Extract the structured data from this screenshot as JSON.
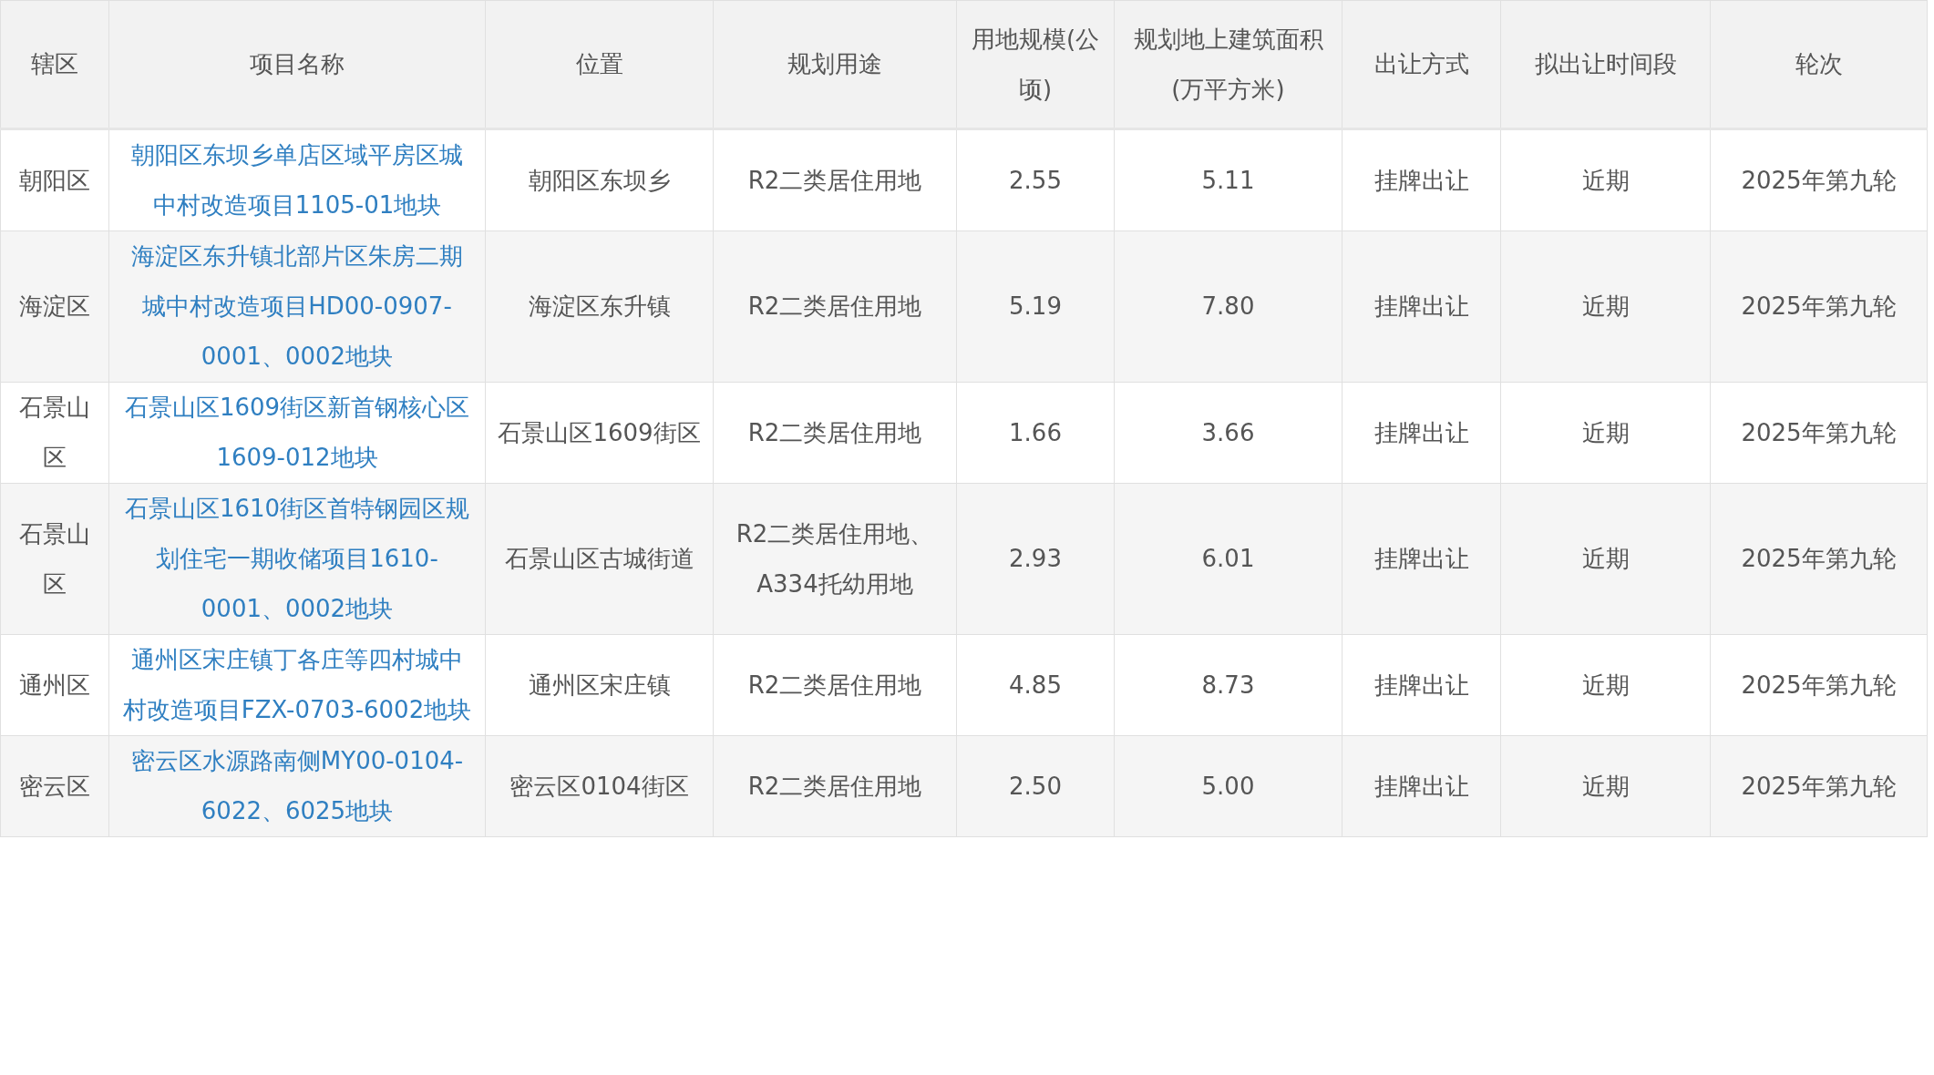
{
  "table": {
    "columns": [
      "辖区",
      "项目名称",
      "位置",
      "规划用途",
      "用地规模(公顷)",
      "规划地上建筑面积(万平方米)",
      "出让方式",
      "拟出让时间段",
      "轮次"
    ],
    "rows": [
      {
        "cells": [
          "朝阳区",
          "朝阳区东坝乡单店区域平房区城中村改造项目1105-01地块",
          "朝阳区东坝乡",
          "R2二类居住用地",
          "2.55",
          "5.11",
          "挂牌出让",
          "近期",
          "2025年第九轮"
        ]
      },
      {
        "cells": [
          "海淀区",
          "海淀区东升镇北部片区朱房二期城中村改造项目HD00-0907-0001、0002地块",
          "海淀区东升镇",
          "R2二类居住用地",
          "5.19",
          "7.80",
          "挂牌出让",
          "近期",
          "2025年第九轮"
        ]
      },
      {
        "cells": [
          "石景山区",
          "石景山区1609街区新首钢核心区1609-012地块",
          "石景山区1609街区",
          "R2二类居住用地",
          "1.66",
          "3.66",
          "挂牌出让",
          "近期",
          "2025年第九轮"
        ]
      },
      {
        "cells": [
          "石景山区",
          "石景山区1610街区首特钢园区规划住宅一期收储项目1610-0001、0002地块",
          "石景山区古城街道",
          "R2二类居住用地、A334托幼用地",
          "2.93",
          "6.01",
          "挂牌出让",
          "近期",
          "2025年第九轮"
        ]
      },
      {
        "cells": [
          "通州区",
          "通州区宋庄镇丁各庄等四村城中村改造项目FZX-0703-6002地块",
          "通州区宋庄镇",
          "R2二类居住用地",
          "4.85",
          "8.73",
          "挂牌出让",
          "近期",
          "2025年第九轮"
        ]
      },
      {
        "cells": [
          "密云区",
          "密云区水源路南侧MY00-0104-6022、6025地块",
          "密云区0104街区",
          "R2二类居住用地",
          "2.50",
          "5.00",
          "挂牌出让",
          "近期",
          "2025年第九轮"
        ]
      }
    ]
  }
}
